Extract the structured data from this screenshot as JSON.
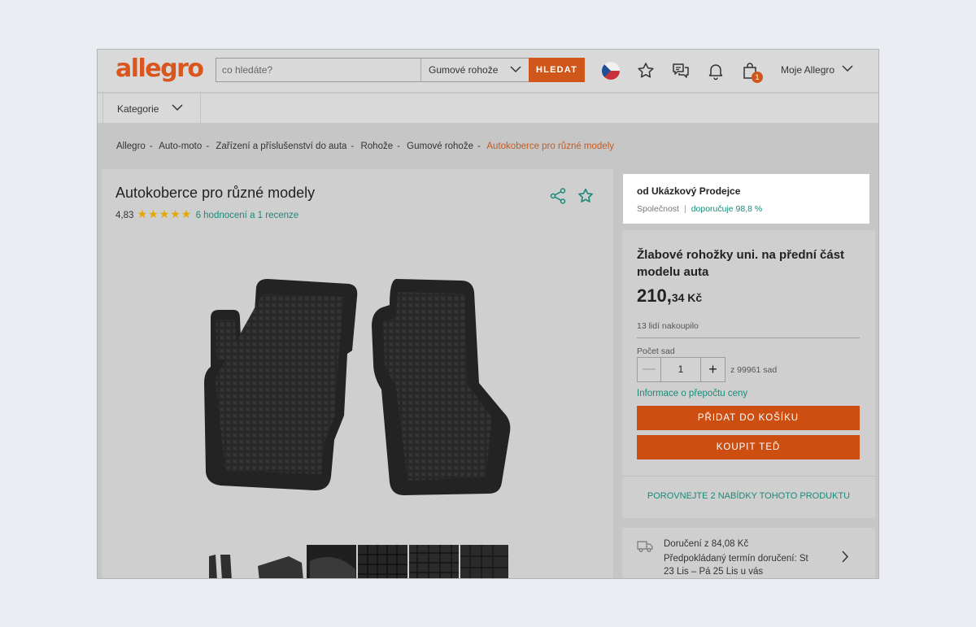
{
  "header": {
    "logo": "allegro",
    "search_placeholder": "co hledáte?",
    "search_category": "Gumové rohože",
    "search_button": "HLEDAT",
    "cart_count": "1",
    "account_label": "Moje Allegro"
  },
  "catbar": {
    "label": "Kategorie"
  },
  "breadcrumbs": [
    "Allegro",
    "Auto-moto",
    "Zařízení a příslušenství do auta",
    "Rohože",
    "Gumové rohože",
    "Autokoberce pro různé modely"
  ],
  "product": {
    "title": "Autokoberce pro různé modely",
    "rating_value": "4,83",
    "rating_stars": 5,
    "rating_link": "6 hodnocení a 1 recenze"
  },
  "seller": {
    "name": "od Ukázkový Prodejce",
    "type": "Společnost",
    "recommend": "doporučuje 98,8 %"
  },
  "offer": {
    "title": "Žlabové rohožky uni. na přední část modelu auta",
    "price_main": "210,",
    "price_cents": "34 Kč",
    "bought": "13 lidí nakoupilo",
    "qty_label": "Počet sad",
    "qty_value": "1",
    "stock": "z 99961 sad",
    "conversion_link": "Informace o přepočtu ceny",
    "add_to_cart": "PŘIDAT DO KOŠÍKU",
    "buy_now": "KOUPIT TEĎ",
    "compare": "POROVNEJTE 2 NABÍDKY TOHOTO PRODUKTU"
  },
  "delivery": {
    "line1": "Doručení z 84,08 Kč",
    "line2": "Předpokládaný termín doručení: St 23 Lis – Pá 25 Lis u vás"
  },
  "colors": {
    "accent": "#cc4e11",
    "link": "#1a8a78",
    "star": "#e2a800"
  },
  "icons": [
    "chevron-down-icon",
    "czech-flag-icon",
    "star-outline-icon",
    "chat-icon",
    "bell-icon",
    "shopping-bag-icon",
    "share-icon",
    "truck-icon",
    "chevron-right-icon"
  ]
}
